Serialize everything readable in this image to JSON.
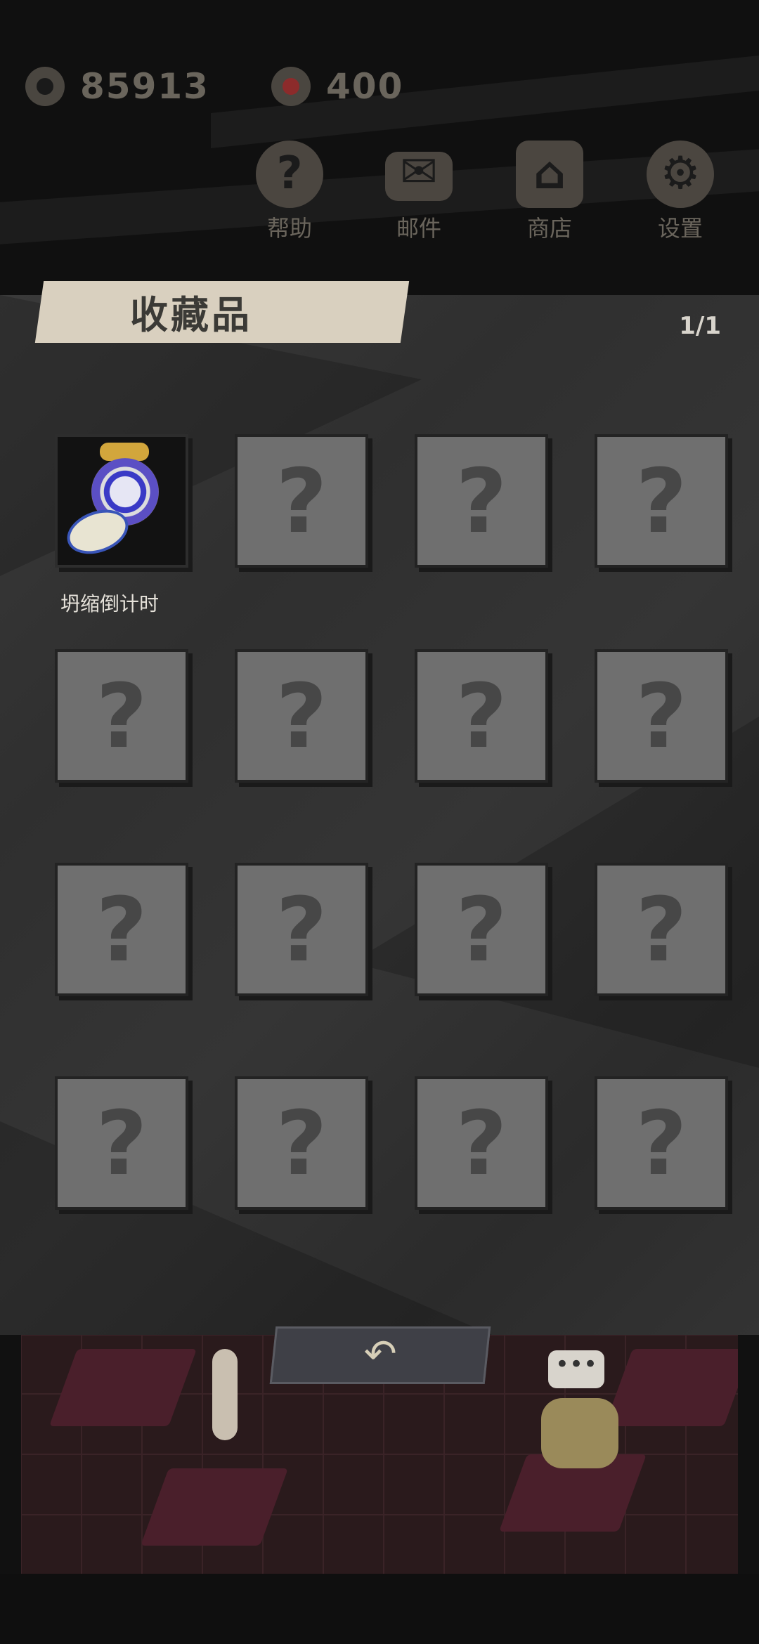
{
  "header": {
    "coins": {
      "icon": "coin-icon",
      "value": "85913"
    },
    "gems": {
      "icon": "eye-gem-icon",
      "value": "400"
    },
    "menu": [
      {
        "icon": "help-icon",
        "label": "帮助"
      },
      {
        "icon": "mail-icon",
        "label": "邮件"
      },
      {
        "icon": "shop-icon",
        "label": "商店"
      },
      {
        "icon": "settings-icon",
        "label": "设置"
      }
    ]
  },
  "collection": {
    "title": "收藏品",
    "page": "1/1",
    "first_item_name": "坍缩倒计时",
    "locked_glyph": "?"
  },
  "back": {
    "icon": "back-arrow-icon",
    "glyph": "↶"
  },
  "scene": {
    "bubble_text": "•••"
  }
}
